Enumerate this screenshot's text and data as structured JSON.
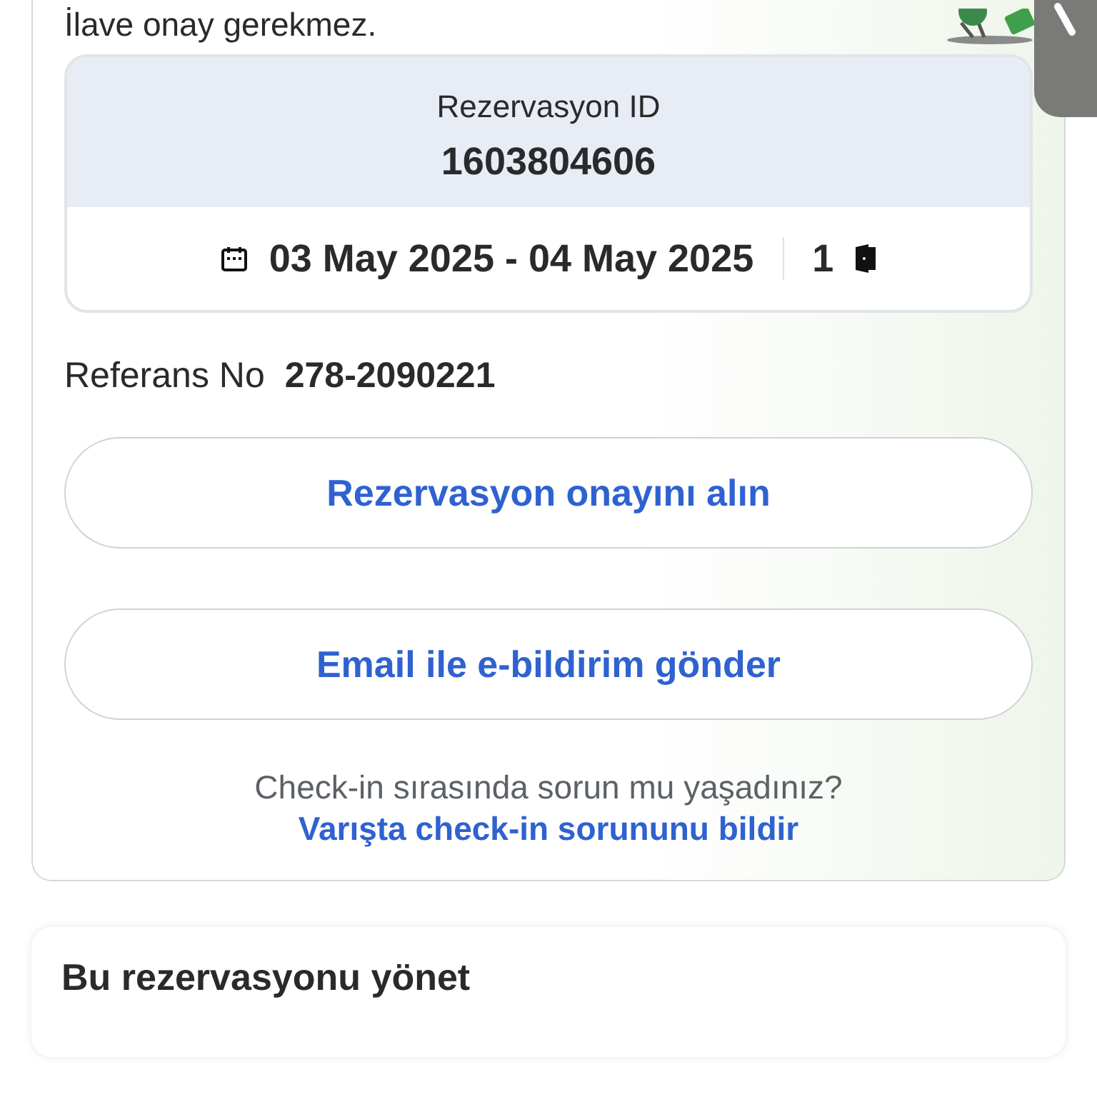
{
  "intro_text": "İlave onay gerekmez.",
  "reservation": {
    "id_label": "Rezervasyon ID",
    "id": "1603804606",
    "dates": "03 May 2025 - 04 May 2025",
    "rooms": "1"
  },
  "reference": {
    "label": "Referans No",
    "value": "278-2090221"
  },
  "buttons": [
    "Rezervasyon onayını alın",
    "Email ile e-bildirim gönder"
  ],
  "help": {
    "question": "Check-in sırasında sorun mu yaşadınız?",
    "link": "Varışta check-in sorununu bildir"
  },
  "manage": {
    "title": "Bu rezervasyonu yönet"
  }
}
